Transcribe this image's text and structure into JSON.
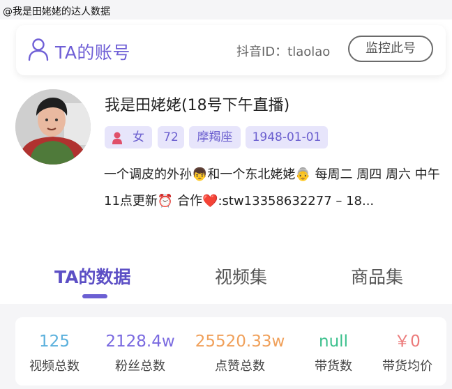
{
  "page_caption": "@我是田姥姥的达人数据",
  "account": {
    "title": "TA的账号",
    "douyin_id": "抖音ID：tlaolao",
    "monitor_button": "监控此号"
  },
  "profile": {
    "name": "我是田姥姥(18号下午直播)",
    "tags": {
      "gender": "女",
      "age": "72",
      "zodiac": "摩羯座",
      "birthday": "1948-01-01"
    },
    "bio": "一个调皮的外孙👦和一个东北姥姥👵 每周二 周四 周六 中午11点更新⏰ 合作❤️:stw13358632277 – 18..."
  },
  "tabs": [
    {
      "label": "TA的数据",
      "active": true
    },
    {
      "label": "视频集",
      "active": false
    },
    {
      "label": "商品集",
      "active": false
    }
  ],
  "stats": [
    {
      "value": "125",
      "label": "视频总数",
      "color": "#5ab0dc"
    },
    {
      "value": "2128.4w",
      "label": "粉丝总数",
      "color": "#7a6ae0"
    },
    {
      "value": "25520.33w",
      "label": "点赞总数",
      "color": "#f0a05a"
    },
    {
      "value": "null",
      "label": "带货数",
      "color": "#3cc08d"
    },
    {
      "value": "￥0",
      "label": "带货均价",
      "color": "#ec7a7a"
    }
  ],
  "colors": {
    "accent": "#6b5fd3",
    "tag_bg": "#e7e5fb"
  },
  "icons": {
    "account": "user-outline-icon",
    "gender": "female-person-icon"
  }
}
